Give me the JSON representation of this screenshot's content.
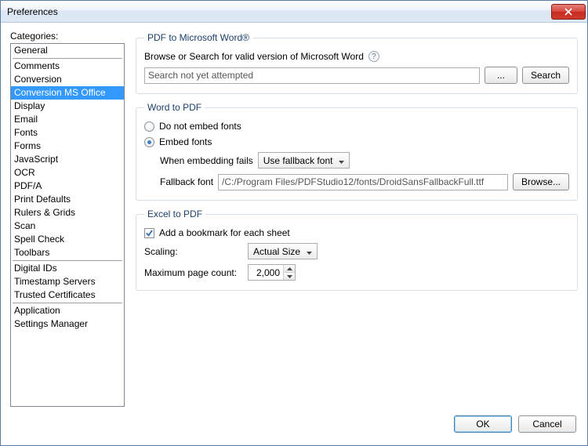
{
  "window": {
    "title": "Preferences"
  },
  "sidebar": {
    "label": "Categories:",
    "groups": [
      [
        "General"
      ],
      [
        "Comments",
        "Conversion",
        "Conversion MS Office",
        "Display",
        "Email",
        "Fonts",
        "Forms",
        "JavaScript",
        "OCR",
        "PDF/A",
        "Print Defaults",
        "Rulers & Grids",
        "Scan",
        "Spell Check",
        "Toolbars"
      ],
      [
        "Digital IDs",
        "Timestamp Servers",
        "Trusted Certificates"
      ],
      [
        "Application",
        "Settings Manager"
      ]
    ],
    "selected": "Conversion MS Office"
  },
  "pdf2word": {
    "legend": "PDF to Microsoft Word®",
    "hint": "Browse or Search for valid version of Microsoft Word",
    "status": "Search not yet attempted",
    "browse_btn": "...",
    "search_btn": "Search"
  },
  "word2pdf": {
    "legend": "Word to PDF",
    "opt_no_embed": "Do not embed fonts",
    "opt_embed": "Embed fonts",
    "embed_selected": true,
    "when_fails_label": "When embedding fails",
    "when_fails_value": "Use fallback font",
    "fallback_label": "Fallback font",
    "fallback_value": "/C:/Program Files/PDFStudio12/fonts/DroidSansFallbackFull.ttf",
    "browse_btn": "Browse..."
  },
  "excel2pdf": {
    "legend": "Excel to PDF",
    "bookmark_label": "Add a bookmark for each sheet",
    "bookmark_checked": true,
    "scaling_label": "Scaling:",
    "scaling_value": "Actual Size",
    "max_label": "Maximum page count:",
    "max_value": "2,000"
  },
  "footer": {
    "ok": "OK",
    "cancel": "Cancel"
  }
}
